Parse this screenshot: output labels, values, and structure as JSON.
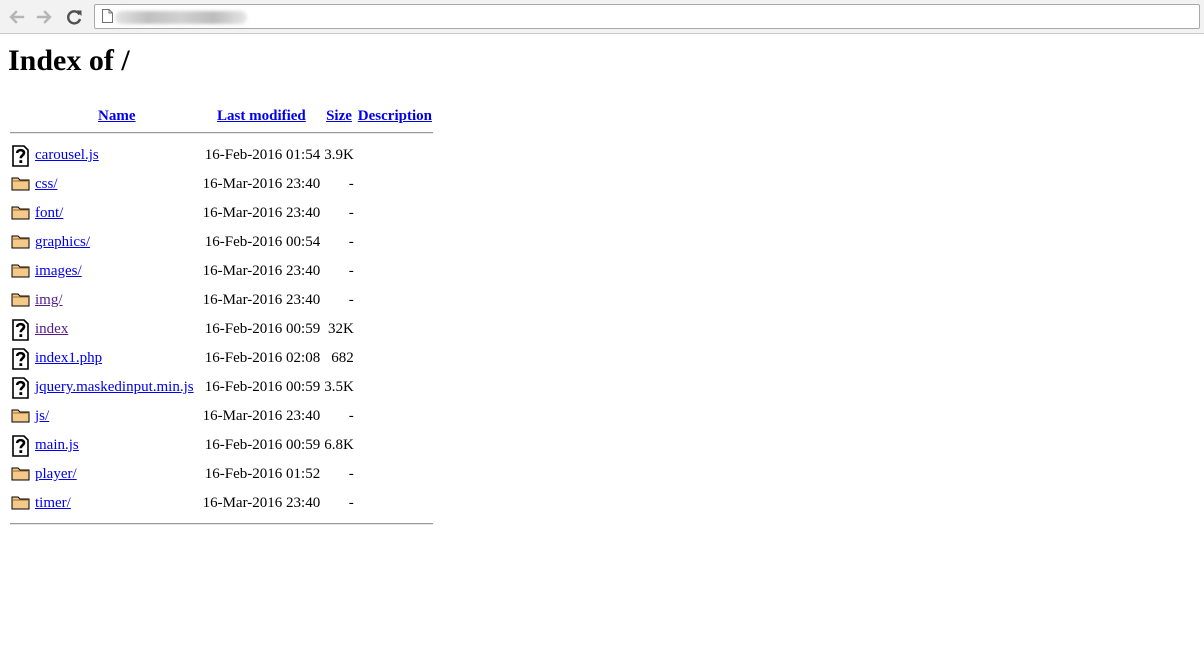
{
  "page": {
    "heading": "Index of /"
  },
  "columns": {
    "name": "Name",
    "modified": "Last modified",
    "size": "Size",
    "description": "Description"
  },
  "entries": [
    {
      "name": "carousel.js",
      "modified": "16-Feb-2016 01:54",
      "size": "3.9K",
      "icon": "unknown-file-icon"
    },
    {
      "name": "css/",
      "modified": "16-Mar-2016 23:40",
      "size": "-",
      "icon": "folder-icon"
    },
    {
      "name": "font/",
      "modified": "16-Mar-2016 23:40",
      "size": "-",
      "icon": "folder-icon"
    },
    {
      "name": "graphics/",
      "modified": "16-Feb-2016 00:54",
      "size": "-",
      "icon": "folder-icon"
    },
    {
      "name": "images/",
      "modified": "16-Mar-2016 23:40",
      "size": "-",
      "icon": "folder-icon"
    },
    {
      "name": "img/",
      "modified": "16-Mar-2016 23:40",
      "size": "-",
      "icon": "folder-icon"
    },
    {
      "name": "index",
      "modified": "16-Feb-2016 00:59",
      "size": "32K",
      "icon": "unknown-file-icon"
    },
    {
      "name": "index1.php",
      "modified": "16-Feb-2016 02:08",
      "size": "682",
      "icon": "unknown-file-icon"
    },
    {
      "name": "jquery.maskedinput.min.js",
      "modified": "16-Feb-2016 00:59",
      "size": "3.5K",
      "icon": "unknown-file-icon"
    },
    {
      "name": "js/",
      "modified": "16-Mar-2016 23:40",
      "size": "-",
      "icon": "folder-icon"
    },
    {
      "name": "main.js",
      "modified": "16-Feb-2016 00:59",
      "size": "6.8K",
      "icon": "unknown-file-icon"
    },
    {
      "name": "player/",
      "modified": "16-Feb-2016 01:52",
      "size": "-",
      "icon": "folder-icon"
    },
    {
      "name": "timer/",
      "modified": "16-Mar-2016 23:40",
      "size": "-",
      "icon": "folder-icon"
    }
  ],
  "colors": {
    "link": "#0000ee",
    "visited_link": "#551a8b",
    "folder": "#f5c98a"
  }
}
